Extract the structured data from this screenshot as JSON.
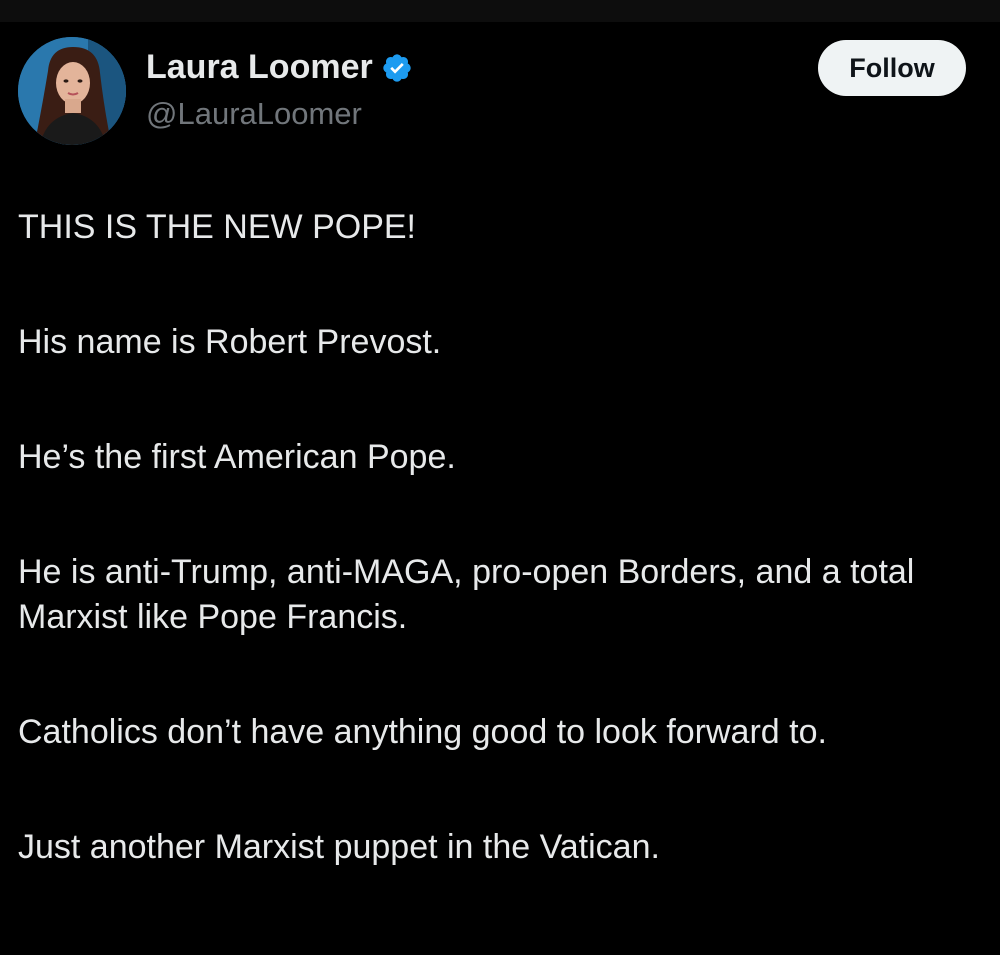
{
  "author": {
    "name": "Laura Loomer",
    "handle": "@LauraLoomer",
    "verified_icon": "verified-badge-icon",
    "badge_color": "#1d9bf0"
  },
  "follow_label": "Follow",
  "post": {
    "paragraphs": [
      "THIS IS THE NEW POPE!",
      "His name is Robert Prevost.",
      "He’s the first American Pope.",
      "He is anti-Trump, anti-MAGA, pro-open Borders, and a total Marxist like Pope Francis.",
      "Catholics don’t have anything good to look forward to.",
      "Just another Marxist puppet in the Vatican."
    ]
  },
  "colors": {
    "background": "#000000",
    "text_primary": "#e7e9ea",
    "text_secondary": "#71767b",
    "follow_bg": "#eff3f4"
  }
}
